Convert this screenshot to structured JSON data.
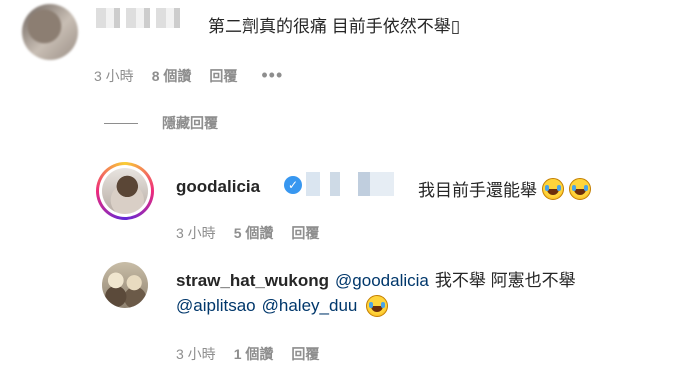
{
  "comment_top": {
    "text": "第二劑真的很痛 目前手依然不舉▯",
    "time": "3 小時",
    "likes": "8 個讚",
    "reply_label": "回覆",
    "more_label": "•••"
  },
  "hide_replies_label": "隱藏回覆",
  "reply1": {
    "username": "goodalicia",
    "verified_mark": "✓",
    "text": "我目前手還能舉",
    "time": "3 小時",
    "likes": "5 個讚",
    "reply_label": "回覆"
  },
  "reply2": {
    "username": "straw_hat_wukong",
    "mention1": "@goodalicia",
    "text": "我不舉 阿憲也不舉",
    "mention2": "@aiplitsao",
    "mention3": "@haley_duu",
    "time": "3 小時",
    "likes": "1 個讚",
    "reply_label": "回覆"
  },
  "colors": {
    "mention": "#00376b",
    "meta": "#8e8e8e",
    "verified": "#3897f0"
  },
  "icons": [
    "verified-badge-icon",
    "laughing-crying-emoji-icon",
    "more-options-icon"
  ]
}
